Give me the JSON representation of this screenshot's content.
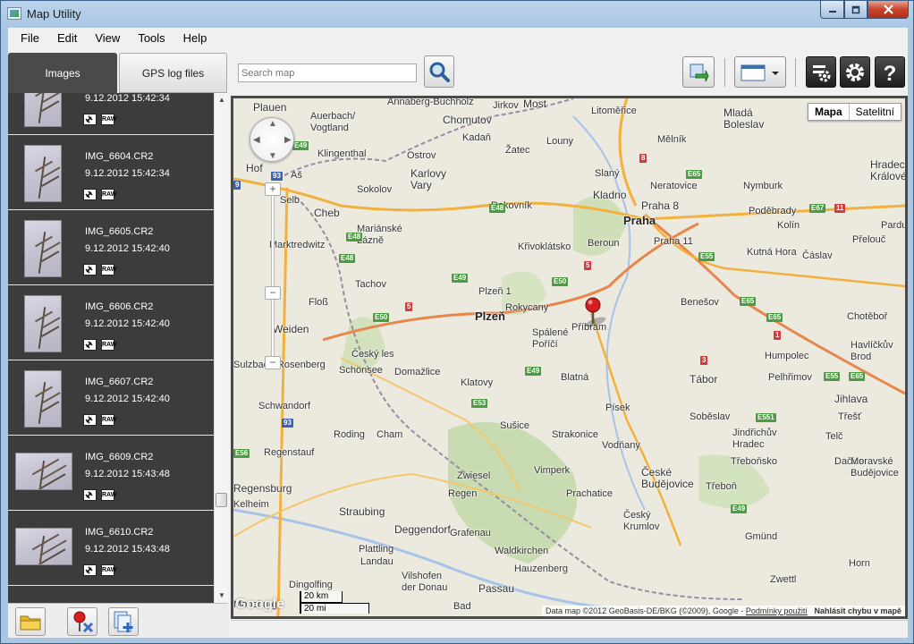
{
  "window": {
    "title": "Map Utility"
  },
  "menu": [
    "File",
    "Edit",
    "View",
    "Tools",
    "Help"
  ],
  "tabs": {
    "images": "Images",
    "gps": "GPS log files"
  },
  "images": [
    {
      "name": "IMG_6603.CR2",
      "date": "9.12.2012 15:42:34",
      "orientation": "portrait"
    },
    {
      "name": "IMG_6604.CR2",
      "date": "9.12.2012 15:42:34",
      "orientation": "portrait"
    },
    {
      "name": "IMG_6605.CR2",
      "date": "9.12.2012 15:42:40",
      "orientation": "portrait"
    },
    {
      "name": "IMG_6606.CR2",
      "date": "9.12.2012 15:42:40",
      "orientation": "portrait"
    },
    {
      "name": "IMG_6607.CR2",
      "date": "9.12.2012 15:42:40",
      "orientation": "portrait"
    },
    {
      "name": "IMG_6609.CR2",
      "date": "9.12.2012 15:43:48",
      "orientation": "landscape"
    },
    {
      "name": "IMG_6610.CR2",
      "date": "9.12.2012 15:43:48",
      "orientation": "landscape"
    }
  ],
  "badges": {
    "raw": "RAW"
  },
  "search": {
    "placeholder": "Search map"
  },
  "map": {
    "type_map": "Mapa",
    "type_satellite": "Satelitní",
    "google": "Google",
    "scale_km": "20 km",
    "scale_mi": "20 mi",
    "copyright": "Data map ©2012 GeoBasis-DE/BKG (©2009), Google - ",
    "terms": "Podmínky použití",
    "report": "Nahlásit chybu v mapě",
    "zoom_in": "+",
    "zoom_out": "−",
    "cities": [
      {
        "n": "Plauen",
        "c": "town"
      },
      {
        "n": "Auerbach/\nVogtland",
        "c": ""
      },
      {
        "n": "Annaberg-Buchholz",
        "c": ""
      },
      {
        "n": "Chomutov",
        "c": "town"
      },
      {
        "n": "Jirkov",
        "c": ""
      },
      {
        "n": "Most",
        "c": "town"
      },
      {
        "n": "Litoměřice",
        "c": ""
      },
      {
        "n": "Mladá\nBoleslav",
        "c": "town"
      },
      {
        "n": "Mělník",
        "c": ""
      },
      {
        "n": "Kadaň",
        "c": ""
      },
      {
        "n": "Žatec",
        "c": ""
      },
      {
        "n": "Louny",
        "c": ""
      },
      {
        "n": "Klingenthal",
        "c": ""
      },
      {
        "n": "Ostrov",
        "c": ""
      },
      {
        "n": "Hof",
        "c": "town"
      },
      {
        "n": "Aš",
        "c": ""
      },
      {
        "n": "Karlovy\nVary",
        "c": "town"
      },
      {
        "n": "Sokolov",
        "c": ""
      },
      {
        "n": "Slaný",
        "c": ""
      },
      {
        "n": "Neratovice",
        "c": ""
      },
      {
        "n": "Kladno",
        "c": "town"
      },
      {
        "n": "Praha 8",
        "c": "town"
      },
      {
        "n": "Praha",
        "c": "big"
      },
      {
        "n": "Nymburk",
        "c": ""
      },
      {
        "n": "Hradec\nKrálové",
        "c": "town"
      },
      {
        "n": "Selb",
        "c": ""
      },
      {
        "n": "Cheb",
        "c": "town"
      },
      {
        "n": "Rakovník",
        "c": ""
      },
      {
        "n": "Poděbrady",
        "c": ""
      },
      {
        "n": "Kolín",
        "c": ""
      },
      {
        "n": "Mariánské\nLázně",
        "c": ""
      },
      {
        "n": "Křivoklátsko",
        "c": ""
      },
      {
        "n": "Beroun",
        "c": ""
      },
      {
        "n": "Praha 11",
        "c": ""
      },
      {
        "n": "Pardubice",
        "c": ""
      },
      {
        "n": "Přelouč",
        "c": ""
      },
      {
        "n": "Marktredwitz",
        "c": ""
      },
      {
        "n": "Kutná Hora",
        "c": ""
      },
      {
        "n": "Čáslav",
        "c": ""
      },
      {
        "n": "Tachov",
        "c": ""
      },
      {
        "n": "Plzeň 1",
        "c": ""
      },
      {
        "n": "Benešov",
        "c": ""
      },
      {
        "n": "Floß",
        "c": ""
      },
      {
        "n": "Plzeň",
        "c": "big"
      },
      {
        "n": "Rokycany",
        "c": ""
      },
      {
        "n": "Příbram",
        "c": ""
      },
      {
        "n": "Chotěboř",
        "c": ""
      },
      {
        "n": "Weiden",
        "c": "town"
      },
      {
        "n": "Spálené\nPoříčí",
        "c": ""
      },
      {
        "n": "Český les",
        "c": ""
      },
      {
        "n": "Havlíčkův\nBrod",
        "c": ""
      },
      {
        "n": "Humpolec",
        "c": ""
      },
      {
        "n": "Sulzbach-Rosenberg",
        "c": ""
      },
      {
        "n": "Schönsee",
        "c": ""
      },
      {
        "n": "Domažlice",
        "c": ""
      },
      {
        "n": "Blatná",
        "c": ""
      },
      {
        "n": "Pelhřimov",
        "c": ""
      },
      {
        "n": "Tábor",
        "c": "town"
      },
      {
        "n": "Jihlava",
        "c": "town"
      },
      {
        "n": "Klatovy",
        "c": ""
      },
      {
        "n": "Schwandorf",
        "c": ""
      },
      {
        "n": "Písek",
        "c": ""
      },
      {
        "n": "Soběslav",
        "c": ""
      },
      {
        "n": "Třešť",
        "c": ""
      },
      {
        "n": "Sušice",
        "c": ""
      },
      {
        "n": "Roding",
        "c": ""
      },
      {
        "n": "Cham",
        "c": ""
      },
      {
        "n": "Strakonice",
        "c": ""
      },
      {
        "n": "Jindřichův\nHradec",
        "c": ""
      },
      {
        "n": "Telč",
        "c": ""
      },
      {
        "n": "Regenstauf",
        "c": ""
      },
      {
        "n": "Vodňany",
        "c": ""
      },
      {
        "n": "Třeboňsko",
        "c": ""
      },
      {
        "n": "Dačice",
        "c": ""
      },
      {
        "n": "Zwiesel",
        "c": ""
      },
      {
        "n": "Vimperk",
        "c": ""
      },
      {
        "n": "České\nBudějovice",
        "c": "town"
      },
      {
        "n": "Moravské\nBudějovice",
        "c": ""
      },
      {
        "n": "Regensburg",
        "c": "town"
      },
      {
        "n": "Regen",
        "c": ""
      },
      {
        "n": "Prachatice",
        "c": ""
      },
      {
        "n": "Třeboň",
        "c": ""
      },
      {
        "n": "Straubing",
        "c": "town"
      },
      {
        "n": "Český\nKrumlov",
        "c": ""
      },
      {
        "n": "Deggendorf",
        "c": "town"
      },
      {
        "n": "Gmünd",
        "c": ""
      },
      {
        "n": "Kelheim",
        "c": ""
      },
      {
        "n": "Plattling",
        "c": ""
      },
      {
        "n": "Grafenau",
        "c": ""
      },
      {
        "n": "Landau",
        "c": ""
      },
      {
        "n": "Waldkirchen",
        "c": ""
      },
      {
        "n": "Horn",
        "c": ""
      },
      {
        "n": "Hauzenberg",
        "c": ""
      },
      {
        "n": "Vilshofen\nder Donau",
        "c": ""
      },
      {
        "n": "Dingolfing",
        "c": ""
      },
      {
        "n": "Zwettl",
        "c": ""
      },
      {
        "n": "Passau",
        "c": "town"
      },
      {
        "n": "Bad",
        "c": ""
      },
      {
        "n": "Moosburg",
        "c": ""
      }
    ],
    "shields": [
      {
        "t": "E49",
        "c": "green"
      },
      {
        "t": "93",
        "c": "blue"
      },
      {
        "t": "9",
        "c": "blue"
      },
      {
        "t": "E48",
        "c": "green"
      },
      {
        "t": "E48",
        "c": "green"
      },
      {
        "t": "E48",
        "c": "green"
      },
      {
        "t": "8",
        "c": "red"
      },
      {
        "t": "E65",
        "c": "green"
      },
      {
        "t": "E67",
        "c": "green"
      },
      {
        "t": "11",
        "c": "red"
      },
      {
        "t": "E55",
        "c": "green"
      },
      {
        "t": "E49",
        "c": "green"
      },
      {
        "t": "E50",
        "c": "green"
      },
      {
        "t": "5",
        "c": "red"
      },
      {
        "t": "E50",
        "c": "green"
      },
      {
        "t": "5",
        "c": "red"
      },
      {
        "t": "E65",
        "c": "green"
      },
      {
        "t": "E65",
        "c": "green"
      },
      {
        "t": "1",
        "c": "red"
      },
      {
        "t": "3",
        "c": "red"
      },
      {
        "t": "E49",
        "c": "green"
      },
      {
        "t": "E53",
        "c": "green"
      },
      {
        "t": "E55",
        "c": "green"
      },
      {
        "t": "E551",
        "c": "green"
      },
      {
        "t": "E65",
        "c": "green"
      },
      {
        "t": "93",
        "c": "blue"
      },
      {
        "t": "E56",
        "c": "green"
      },
      {
        "t": "E49",
        "c": "green"
      }
    ]
  }
}
